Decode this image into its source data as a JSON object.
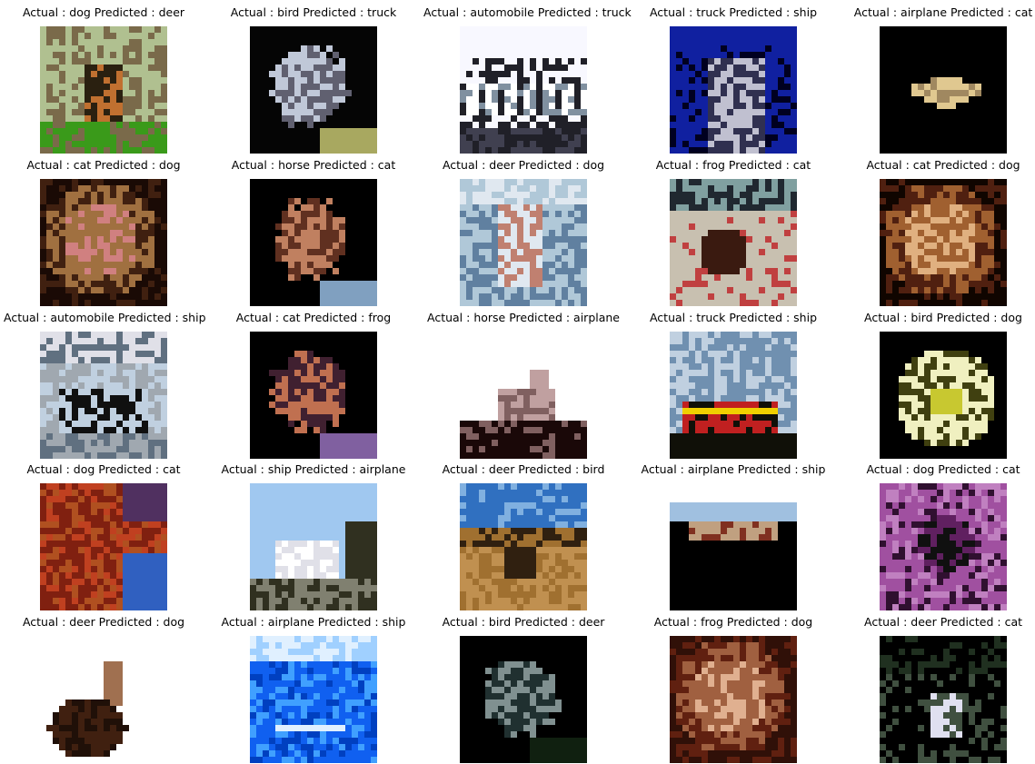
{
  "grid": {
    "rows": 5,
    "cols": 5,
    "cells": [
      {
        "actual": "dog",
        "predicted": "deer",
        "caption": "Actual : dog Predicted : deer",
        "palette": [
          "#7a6a4a",
          "#3a9a1a",
          "#b0c090",
          "#2a2010",
          "#c07030"
        ],
        "scene": "dog_grass"
      },
      {
        "actual": "bird",
        "predicted": "truck",
        "caption": "Actual : bird Predicted : truck",
        "palette": [
          "#050505",
          "#c0c8d8",
          "#606070",
          "#a8a860",
          "#ffffff"
        ],
        "scene": "dark_blob"
      },
      {
        "actual": "automobile",
        "predicted": "truck",
        "caption": "Actual : automobile Predicted : truck",
        "palette": [
          "#f8f8ff",
          "#202028",
          "#8090a0",
          "#ffffff",
          "#404050"
        ],
        "scene": "vintage_car"
      },
      {
        "actual": "truck",
        "predicted": "ship",
        "caption": "Actual : truck Predicted : ship",
        "palette": [
          "#1020a0",
          "#c0c0d0",
          "#303050",
          "#707080",
          "#000020"
        ],
        "scene": "truck_blue"
      },
      {
        "actual": "airplane",
        "predicted": "cat",
        "caption": "Actual : airplane Predicted : cat",
        "palette": [
          "#000000",
          "#e0c890",
          "#a08860",
          "#303020",
          "#000000"
        ],
        "scene": "delta_wing"
      },
      {
        "actual": "cat",
        "predicted": "dog",
        "caption": "Actual : cat Predicted : dog",
        "palette": [
          "#1a0a05",
          "#a07040",
          "#d08080",
          "#402010",
          "#000000"
        ],
        "scene": "brown_face"
      },
      {
        "actual": "horse",
        "predicted": "cat",
        "caption": "Actual : horse Predicted : cat",
        "palette": [
          "#000000",
          "#c08060",
          "#603020",
          "#80a0c0",
          "#101020"
        ],
        "scene": "dark_blob"
      },
      {
        "actual": "deer",
        "predicted": "dog",
        "caption": "Actual : deer Predicted : dog",
        "palette": [
          "#b0c8d8",
          "#c08070",
          "#203050",
          "#e0e8f0",
          "#6080a0"
        ],
        "scene": "light_animal"
      },
      {
        "actual": "frog",
        "predicted": "cat",
        "caption": "Actual : frog Predicted : cat",
        "palette": [
          "#202830",
          "#c8c0b0",
          "#3a1a10",
          "#80a0a0",
          "#c04040"
        ],
        "scene": "frog_light"
      },
      {
        "actual": "cat",
        "predicted": "dog",
        "caption": "Actual : cat Predicted : dog",
        "palette": [
          "#100500",
          "#a06030",
          "#e0b080",
          "#502010",
          "#000000"
        ],
        "scene": "brown_face"
      },
      {
        "actual": "automobile",
        "predicted": "ship",
        "caption": "Actual : automobile Predicted : ship",
        "palette": [
          "#607080",
          "#c0d0e0",
          "#101010",
          "#a0a8b0",
          "#e0e0e8"
        ],
        "scene": "car_front"
      },
      {
        "actual": "cat",
        "predicted": "frog",
        "caption": "Actual : cat Predicted : frog",
        "palette": [
          "#000000",
          "#c07050",
          "#402030",
          "#8060a0",
          "#ffffff"
        ],
        "scene": "dark_blob"
      },
      {
        "actual": "horse",
        "predicted": "airplane",
        "caption": "Actual : horse Predicted : airplane",
        "palette": [
          "#ffffff",
          "#1a0808",
          "#c0a0a0",
          "#806060",
          "#ffffff"
        ],
        "scene": "horse_white"
      },
      {
        "actual": "truck",
        "predicted": "ship",
        "caption": "Actual : truck Predicted : ship",
        "palette": [
          "#7090b0",
          "#c0d0e0",
          "#101008",
          "#c02020",
          "#f0d000"
        ],
        "scene": "sky_truck"
      },
      {
        "actual": "bird",
        "predicted": "dog",
        "caption": "Actual : bird Predicted : dog",
        "palette": [
          "#000000",
          "#f0f0c0",
          "#c8c830",
          "#404010",
          "#ffffff"
        ],
        "scene": "bird_face"
      },
      {
        "actual": "dog",
        "predicted": "cat",
        "caption": "Actual : dog Predicted : cat",
        "palette": [
          "#802010",
          "#b05020",
          "#3060c0",
          "#503060",
          "#c04020"
        ],
        "scene": "red_dog"
      },
      {
        "actual": "ship",
        "predicted": "airplane",
        "caption": "Actual : ship Predicted : airplane",
        "palette": [
          "#a0c8f0",
          "#e0e0e8",
          "#303020",
          "#808070",
          "#ffffff"
        ],
        "scene": "sky_ship"
      },
      {
        "actual": "deer",
        "predicted": "bird",
        "caption": "Actual : deer Predicted : bird",
        "palette": [
          "#3070c0",
          "#a07030",
          "#302010",
          "#c09050",
          "#80b0e0"
        ],
        "scene": "landscape"
      },
      {
        "actual": "airplane",
        "predicted": "ship",
        "caption": "Actual : airplane Predicted : ship",
        "palette": [
          "#ffffff",
          "#000000",
          "#c0a080",
          "#803020",
          "#a0c0e0"
        ],
        "scene": "plane_dark"
      },
      {
        "actual": "dog",
        "predicted": "cat",
        "caption": "Actual : dog Predicted : cat",
        "palette": [
          "#301030",
          "#a050a0",
          "#101010",
          "#c080c0",
          "#602060"
        ],
        "scene": "purple"
      },
      {
        "actual": "deer",
        "predicted": "dog",
        "caption": "Actual : deer Predicted : dog",
        "palette": [
          "#ffffff",
          "#402010",
          "#a07050",
          "#201008",
          "#ffffff"
        ],
        "scene": "deer_white"
      },
      {
        "actual": "airplane",
        "predicted": "ship",
        "caption": "Actual : airplane Predicted : ship",
        "palette": [
          "#1060f0",
          "#40a0ff",
          "#e0f0ff",
          "#0040c0",
          "#a0d0ff"
        ],
        "scene": "blue_plane"
      },
      {
        "actual": "bird",
        "predicted": "deer",
        "caption": "Actual : bird Predicted : deer",
        "palette": [
          "#000000",
          "#203030",
          "#809090",
          "#102010",
          "#c0c0c0"
        ],
        "scene": "dark_blob"
      },
      {
        "actual": "frog",
        "predicted": "dog",
        "caption": "Actual : frog Predicted : dog",
        "palette": [
          "#301008",
          "#a06040",
          "#e0b090",
          "#602010",
          "#c08060"
        ],
        "scene": "brown_face"
      },
      {
        "actual": "deer",
        "predicted": "cat",
        "caption": "Actual : deer Predicted : cat",
        "palette": [
          "#000000",
          "#203020",
          "#e0e0f0",
          "#405040",
          "#000000"
        ],
        "scene": "dark_deer"
      }
    ]
  }
}
